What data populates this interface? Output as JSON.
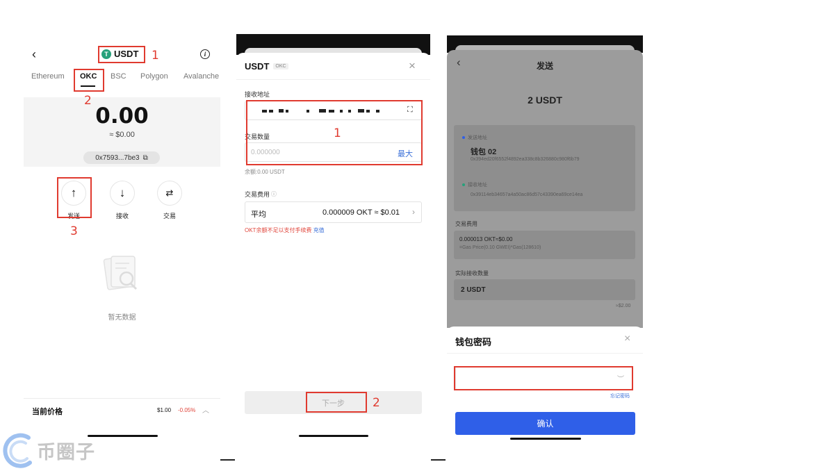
{
  "panel1": {
    "token": "USDT",
    "tabs": [
      "Ethereum",
      "OKC",
      "BSC",
      "Polygon",
      "Avalanche"
    ],
    "active_tab": "OKC",
    "balance": "0.00",
    "balance_usd": "≈ $0.00",
    "address": "0x7593...7be3",
    "actions": [
      {
        "label": "发送",
        "icon": "arrow-up-icon"
      },
      {
        "label": "接收",
        "icon": "arrow-down-icon"
      },
      {
        "label": "交易",
        "icon": "swap-icon"
      }
    ],
    "empty_text": "暂无数据",
    "price_label": "当前价格",
    "price_value": "$1.00",
    "price_change": "-0.05%",
    "annotations": [
      "1",
      "2",
      "3"
    ]
  },
  "panel2": {
    "title": "USDT",
    "chain_badge": "OKC",
    "recipient_label": "接收地址",
    "amount_label": "交易数量",
    "amount_placeholder": "0.000000",
    "max_label": "最大",
    "balance_text": "余额:0.00 USDT",
    "fee_label": "交易费用",
    "fee_speed": "平均",
    "fee_value": "0.000009 OKT ≈ $0.01",
    "warning_text": "OKT余额不足以支付手续费",
    "recharge_link": "充值",
    "next_button": "下一步",
    "annotations": [
      "1",
      "2"
    ]
  },
  "panel3": {
    "title": "发送",
    "amount": "2 USDT",
    "from_label": "发送地址",
    "from_name": "钱包 02",
    "from_address": "0x394ed20f6552f4892ea338c8b326880c980f6b79",
    "to_label": "接收地址",
    "to_address": "0x39114eb34657a4a50ac86d57c43390ea69ce14ea",
    "fee_label": "交易费用",
    "fee_value": "0.000013 OKT≈$0.00",
    "fee_detail": "=Gas Price(0.10 GWEI)*Gas(128610)",
    "receive_label": "实际接收数量",
    "receive_value": "2 USDT",
    "receive_usd": "≈$2.00",
    "password_title": "钱包密码",
    "forgot_password": "忘记密码",
    "confirm_button": "确认"
  },
  "watermark": "币圈子",
  "colors": {
    "annotation_red": "#e03a2f",
    "confirm_blue": "#2f5fe8",
    "link_blue": "#3a6fd8",
    "tether_green": "#26a17b",
    "price_red": "#e0443a"
  }
}
